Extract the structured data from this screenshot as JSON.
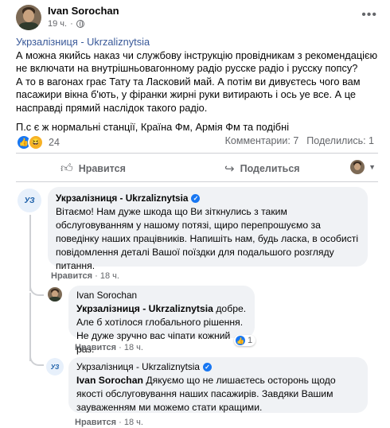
{
  "post": {
    "author": "Ivan Sorochan",
    "time": "19 ч.",
    "mention": "Укрзалізниця - Ukrzaliznytsia",
    "body_line1": " А можна якийсь наказ чи службову інструкцію провідникам з рекомендацією не включати на внутрішньовагонному радіо русске радіо і русску попсу?",
    "body_line2": "А то в вагонах грає Тату та Ласковий май. А потім ви дивуєтесь чого вам пасажири вікна б'ють, у фіранки жирні руки витирають і ось уе все. А це насправді прямий наслідок такого радіо.",
    "body_line3": "П.с є ж нормальні станції, Країна Фм, Армія Фм та подібні",
    "reaction_count": "24",
    "comments_count": "Комментарии: 7",
    "shares_count": "Поделились: 1"
  },
  "actions": {
    "like": "Нравится",
    "share": "Поделиться"
  },
  "comments": [
    {
      "author": "Укрзалізниця - Ukrzaliznytsia",
      "logo": "УЗ",
      "text": "Вітаємо! Нам дуже шкода що Ви зіткнулись з таким обслуговуванням у нашому потязі, щиро перепрошуємо за поведінку наших працівників. Напишіть нам, будь ласка, в особисті повідомлення деталі Вашої поїздки для подальшого розгляду питання.",
      "like_label": "Нравится",
      "time": "18 ч."
    },
    {
      "author": "Ivan Sorochan",
      "mention": "Укрзалізниця - Ukrzaliznytsia",
      "text1": " добре.",
      "text2": "Але б хотілося глобального рішення.",
      "text3": "Не дуже зручно вас чіпати кожний раз.",
      "like_label": "Нравится",
      "time": "18 ч.",
      "reaction_count": "1"
    },
    {
      "author": "Укрзалізниця - Ukrzaliznytsia",
      "logo": "УЗ",
      "mention": "Ivan Sorochan",
      "text": " Дякуємо що не лишаєтесь осторонь щодо якості обслуговування наших пасажирів. Завдяки Вашим зауваженням ми можемо стати кращими.",
      "like_label": "Нравится",
      "time": "18 ч."
    }
  ],
  "colors": {
    "accent": "#1877f2",
    "link": "#385898",
    "bubble": "#f0f2f5",
    "muted": "#65676b"
  }
}
